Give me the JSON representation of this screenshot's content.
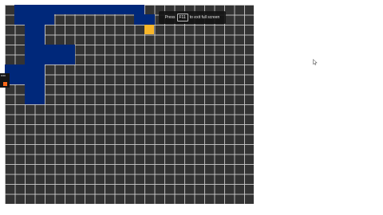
{
  "fullscreen_hint": {
    "prefix": "Press",
    "key": "F11",
    "suffix": "to exit full screen"
  },
  "side_tag": {
    "label": "0:00"
  },
  "colors": {
    "board_background": "#333333",
    "grid_line": "#d2d2d2",
    "path": "#00287a",
    "goal": "#f8b62a",
    "player": "#ff6a1a"
  },
  "icons": {
    "cursor": "mouse-pointer-icon"
  }
}
